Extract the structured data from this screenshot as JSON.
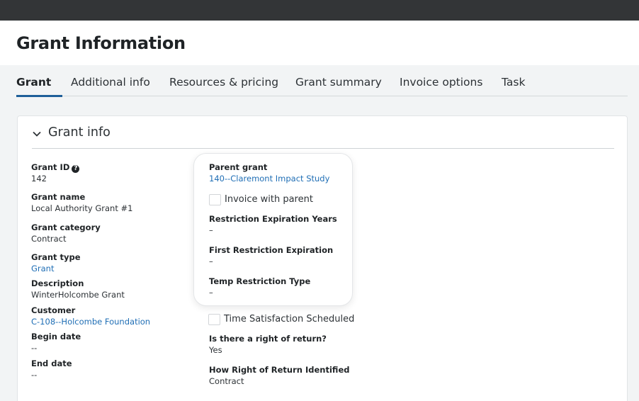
{
  "page": {
    "title": "Grant Information"
  },
  "tabs": [
    {
      "label": "Grant",
      "active": true
    },
    {
      "label": "Additional info"
    },
    {
      "label": "Resources & pricing"
    },
    {
      "label": "Grant summary"
    },
    {
      "label": "Invoice options"
    },
    {
      "label": "Task"
    }
  ],
  "section": {
    "title": "Grant info",
    "icon": "chevron-down-icon"
  },
  "left_fields": {
    "grant_id": {
      "label": "Grant ID",
      "value": "142",
      "icon": "help-icon"
    },
    "grant_name": {
      "label": "Grant name",
      "value": "Local Authority Grant #1"
    },
    "grant_category": {
      "label": "Grant category",
      "value": "Contract"
    },
    "grant_type": {
      "label": "Grant type",
      "value": "Grant"
    },
    "description": {
      "label": "Description",
      "value": "WinterHolcombe Grant"
    },
    "customer": {
      "label": "Customer",
      "value": "C-108--Holcombe Foundation"
    },
    "begin_date": {
      "label": "Begin date",
      "value": "--"
    },
    "end_date": {
      "label": "End date",
      "value": "--"
    }
  },
  "popover": {
    "parent_grant": {
      "label": "Parent grant",
      "value": "140--Claremont Impact Study"
    },
    "invoice_with_parent": {
      "label": "Invoice with parent",
      "checked": false
    },
    "restriction_expiration_years": {
      "label": "Restriction Expiration Years",
      "value": "–"
    },
    "first_restriction_expiration": {
      "label": "First Restriction Expiration",
      "value": "–"
    },
    "temp_restriction_type": {
      "label": "Temp Restriction Type",
      "value": "–"
    }
  },
  "right_fields": {
    "time_satisfaction_scheduled": {
      "label": "Time Satisfaction Scheduled",
      "checked": false
    },
    "right_of_return": {
      "label": "Is there a right of return?",
      "value": "Yes"
    },
    "how_right_of_return": {
      "label": "How Right of Return Identified",
      "value": "Contract"
    }
  },
  "colors": {
    "topbar": "#333537",
    "link": "#1f6eb5",
    "tab_underline": "#1f5f99"
  }
}
